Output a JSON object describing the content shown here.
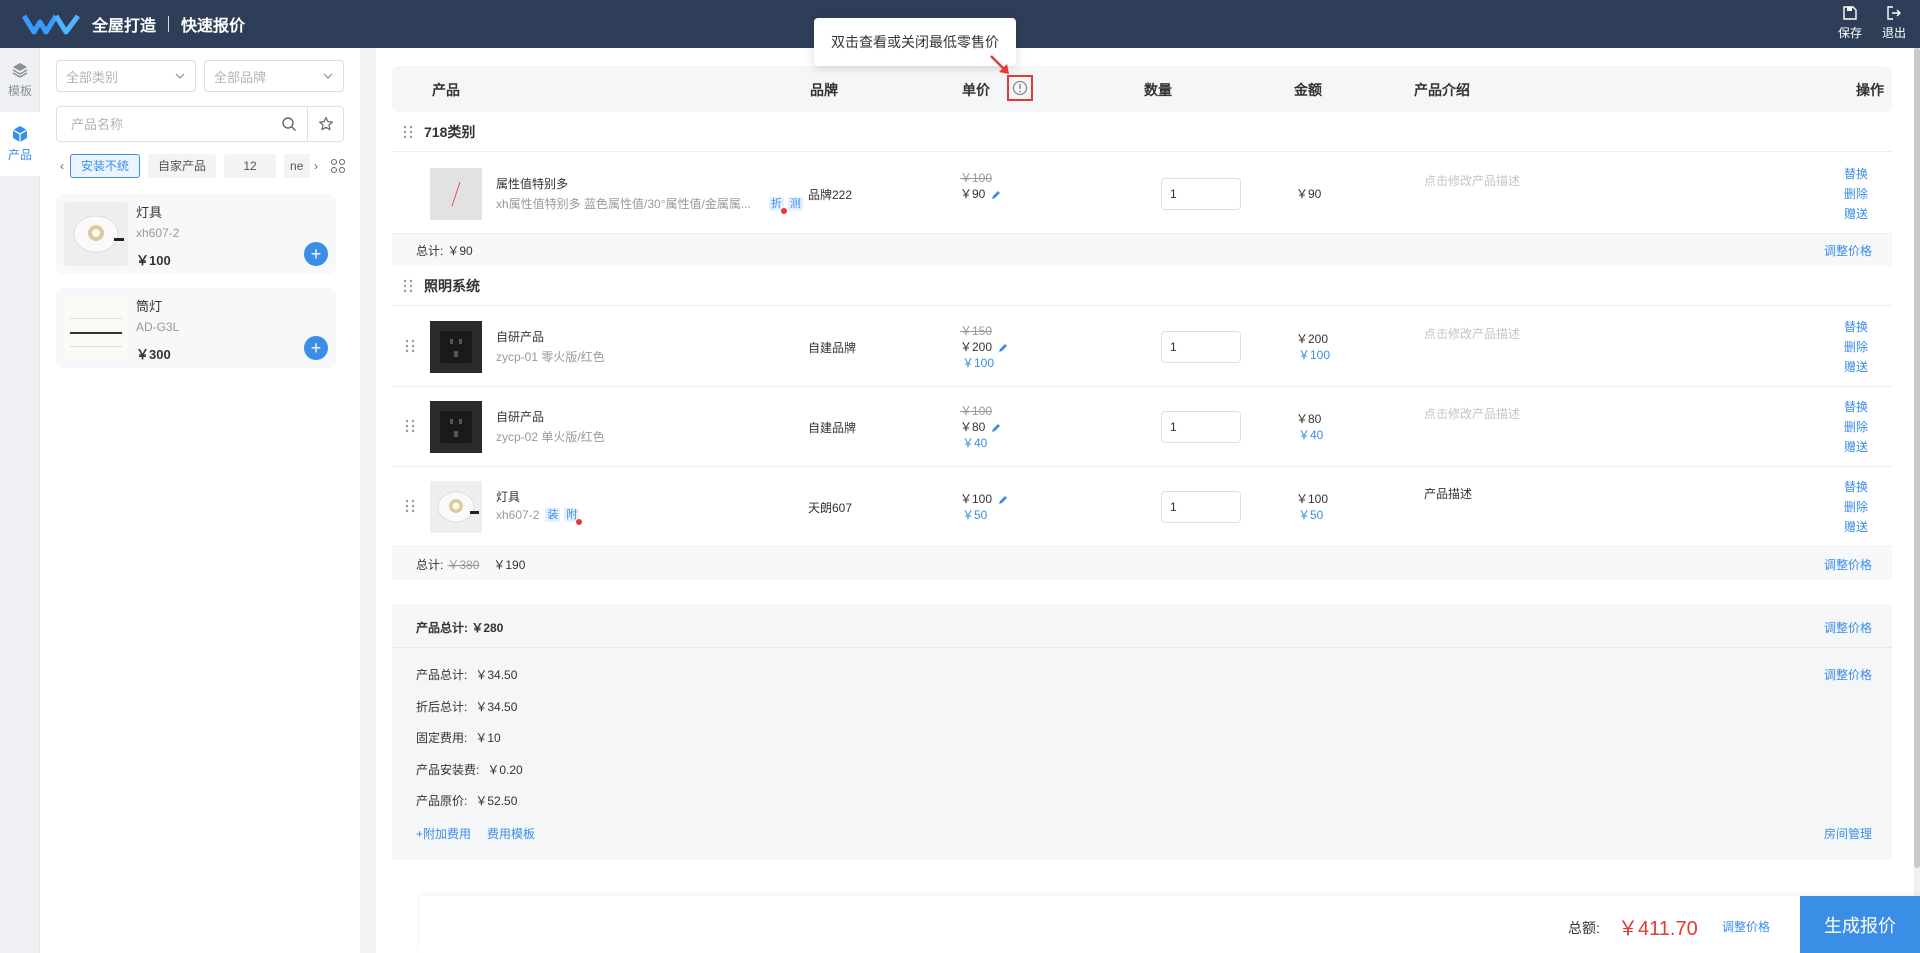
{
  "header": {
    "app_title": "全屋打造",
    "page_title": "快速报价",
    "actions": [
      {
        "label": "保存",
        "icon": "save-icon"
      },
      {
        "label": "退出",
        "icon": "exit-icon"
      }
    ]
  },
  "rail": {
    "items": [
      {
        "label": "模板",
        "icon": "layers-icon",
        "active": false
      },
      {
        "label": "产品",
        "icon": "cube-icon",
        "active": true
      }
    ]
  },
  "panel": {
    "category_select": "全部类别",
    "brand_select": "全部品牌",
    "search_placeholder": "产品名称",
    "chips": [
      "安装不统",
      "自家产品",
      "12",
      "ne"
    ],
    "products": [
      {
        "name": "灯具",
        "model": "xh607-2",
        "price": "￥100"
      },
      {
        "name": "筒灯",
        "model": "AD-G3L",
        "price": "￥300"
      }
    ]
  },
  "table": {
    "headers": {
      "product": "产品",
      "brand": "品牌",
      "unit_price": "单价",
      "quantity": "数量",
      "amount": "金额",
      "intro": "产品介绍",
      "actions": "操作"
    },
    "tooltip": "双击查看或关闭最低零售价",
    "row_actions": [
      "替换",
      "删除",
      "赠送"
    ],
    "desc_placeholder": "点击修改产品描述",
    "adjust_label": "调整价格",
    "groups": [
      {
        "title": "718类别",
        "rows": [
          {
            "name": "属性值特别多",
            "sub": "xh属性值特别多 蓝色属性值/30°属性值/金属属...",
            "tags": [
              "折",
              "测"
            ],
            "brand": "品牌222",
            "orig_price": "￥100",
            "price": "￥90",
            "min_price": "",
            "qty": "1",
            "amount": "￥90",
            "amount_min": "",
            "desc": ""
          }
        ],
        "subtotal_label": "总计:",
        "subtotal_strike": "",
        "subtotal_value": "￥90"
      },
      {
        "title": "照明系统",
        "rows": [
          {
            "name": "自研产品",
            "sub": "zycp-01 零火版/红色",
            "tags": [],
            "brand": "自建品牌",
            "orig_price": "￥150",
            "price": "￥200",
            "min_price": "￥100",
            "qty": "1",
            "amount": "￥200",
            "amount_min": "￥100",
            "desc": ""
          },
          {
            "name": "自研产品",
            "sub": "zycp-02 单火版/红色",
            "tags": [],
            "brand": "自建品牌",
            "orig_price": "￥100",
            "price": "￥80",
            "min_price": "￥40",
            "qty": "1",
            "amount": "￥80",
            "amount_min": "￥40",
            "desc": ""
          },
          {
            "name": "灯具",
            "sub": "xh607-2",
            "tags": [
              "装",
              "附"
            ],
            "brand": "天朗607",
            "orig_price": "",
            "price": "￥100",
            "min_price": "￥50",
            "qty": "1",
            "amount": "￥100",
            "amount_min": "￥50",
            "desc": "产品描述"
          }
        ],
        "subtotal_label": "总计:",
        "subtotal_strike": "￥380",
        "subtotal_value": "￥190"
      }
    ]
  },
  "summary": {
    "product_total": "产品总计: ￥280",
    "lines": [
      {
        "label": "产品总计:",
        "value": "￥34.50"
      },
      {
        "label": "折后总计:",
        "value": "￥34.50"
      },
      {
        "label": "固定费用:",
        "value": "￥10"
      },
      {
        "label": "产品安装费:",
        "value": "￥0.20"
      },
      {
        "label": "产品原价:",
        "value": "￥52.50"
      }
    ],
    "extra_fee": "+附加费用",
    "fee_template": "费用模板",
    "room_manage": "房间管理"
  },
  "footer": {
    "total_label": "总额:",
    "total_value": "￥411.70",
    "adjust": "调整价格",
    "generate": "生成报价"
  },
  "colors": {
    "topbar": "#2f3e58",
    "accent": "#3a8ee6",
    "danger": "#e53935"
  }
}
